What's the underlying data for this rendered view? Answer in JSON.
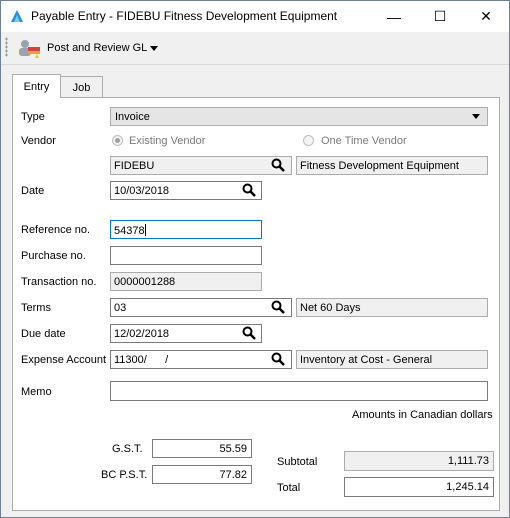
{
  "window": {
    "title": "Payable Entry - FIDEBU Fitness Development Equipment",
    "minimize_glyph": "—",
    "maximize_glyph": "☐",
    "close_glyph": "✕"
  },
  "toolbar": {
    "post_label": "Post and Review GL",
    "post_icon": "post-review-gl-icon"
  },
  "tabs": [
    {
      "label": "Entry",
      "active": true
    },
    {
      "label": "Job",
      "active": false
    }
  ],
  "form": {
    "type": {
      "label": "Type",
      "value": "Invoice"
    },
    "vendor": {
      "label": "Vendor",
      "existing_label": "Existing Vendor",
      "one_time_label": "One Time Vendor",
      "selected": "existing",
      "code": "FIDEBU",
      "name": "Fitness Development Equipment"
    },
    "date": {
      "label": "Date",
      "value": "10/03/2018"
    },
    "reference": {
      "label": "Reference no.",
      "value": "54378"
    },
    "purchase": {
      "label": "Purchase no.",
      "value": ""
    },
    "transaction": {
      "label": "Transaction no.",
      "value": "0000001288"
    },
    "terms": {
      "label": "Terms",
      "code": "03",
      "description": "Net 60 Days"
    },
    "due_date": {
      "label": "Due date",
      "value": "12/02/2018"
    },
    "expense_account": {
      "label": "Expense Account",
      "value": "11300/      /",
      "description": "Inventory at Cost - General"
    },
    "memo": {
      "label": "Memo",
      "value": ""
    }
  },
  "amounts_note": "Amounts in Canadian dollars",
  "taxes": [
    {
      "label": "G.S.T.",
      "value": "55.59"
    },
    {
      "label": "BC P.S.T.",
      "value": "77.82"
    }
  ],
  "totals": {
    "subtotal_label": "Subtotal",
    "subtotal_value": "1,111.73",
    "total_label": "Total",
    "total_value": "1,245.14"
  }
}
